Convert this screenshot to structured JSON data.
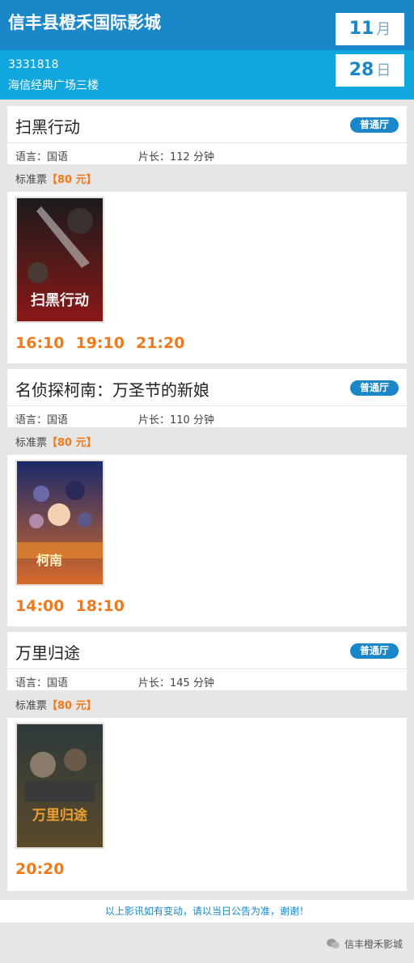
{
  "header": {
    "cinema_name": "信丰县橙禾国际影城",
    "phone": "3331818",
    "address": "海信经典广场三楼",
    "month": "11",
    "month_unit": "月",
    "day": "28",
    "day_unit": "日"
  },
  "movies": [
    {
      "title": "扫黑行动",
      "hall": "普通厅",
      "language": "语言：国语",
      "duration": "片长：112 分钟",
      "price_label": "标准票",
      "price": "【80 元】",
      "times": [
        "16:10",
        "19:10",
        "21:20"
      ],
      "poster": {
        "text": "扫黑行动",
        "colors": [
          "#1b1b1b",
          "#8a1818"
        ]
      }
    },
    {
      "title": "名侦探柯南：万圣节的新娘",
      "hall": "普通厅",
      "language": "语言：国语",
      "duration": "片长：110 分钟",
      "price_label": "标准票",
      "price": "【80 元】",
      "times": [
        "14:00",
        "18:10"
      ],
      "poster": {
        "text": "柯南",
        "colors": [
          "#1a2a6b",
          "#d76a2a"
        ]
      }
    },
    {
      "title": "万里归途",
      "hall": "普通厅",
      "language": "语言：国语",
      "duration": "片长：145 分钟",
      "price_label": "标准票",
      "price": "【80 元】",
      "times": [
        "20:20"
      ],
      "poster": {
        "text": "万里归途",
        "colors": [
          "#2d3a3c",
          "#c98a2a"
        ]
      }
    }
  ],
  "footer": {
    "notice": "以上影讯如有变动，请以当日公告为准，谢谢！",
    "wechat_name": "信丰橙禾影城"
  },
  "colors": {
    "accent": "#1a87c8",
    "price": "#f07a1b"
  }
}
